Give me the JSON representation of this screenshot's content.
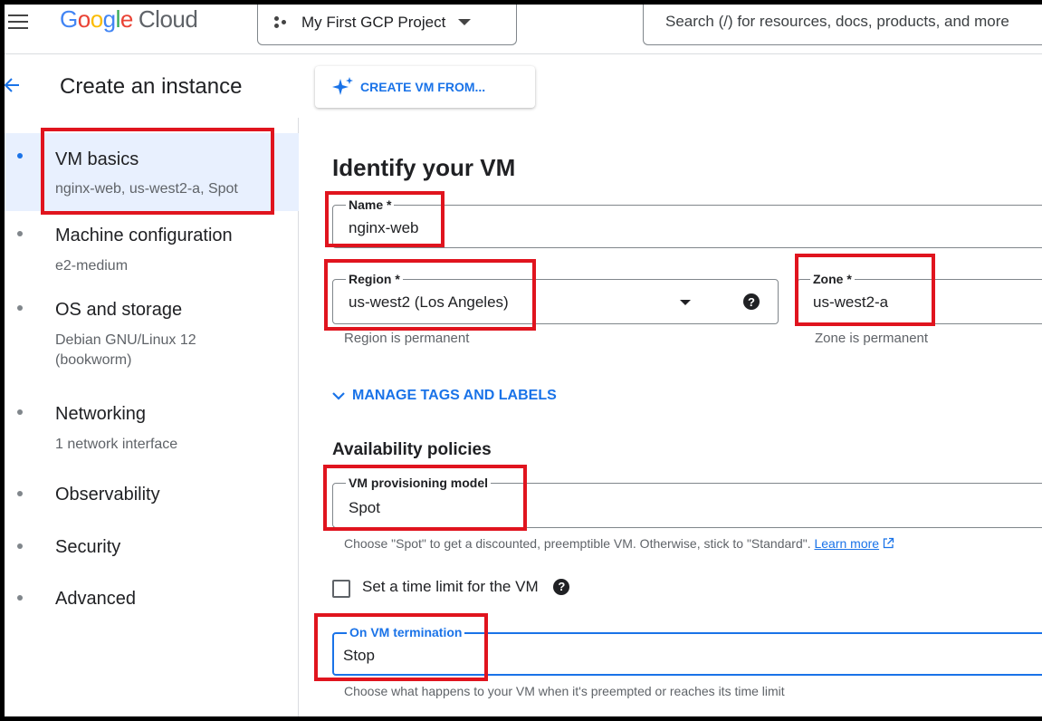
{
  "app": {
    "logo_text": "Google",
    "logo_suffix": "Cloud",
    "project_name": "My First GCP Project",
    "search_placeholder": "Search (/) for resources, docs, products, and more"
  },
  "header": {
    "title": "Create an instance",
    "create_vm_button": "CREATE VM FROM..."
  },
  "sidebar": {
    "items": [
      {
        "label": "VM basics",
        "sub": "nginx-web, us-west2-a, Spot"
      },
      {
        "label": "Machine configuration",
        "sub": "e2-medium"
      },
      {
        "label": "OS and storage",
        "sub": "Debian GNU/Linux 12 (bookworm)"
      },
      {
        "label": "Networking",
        "sub": "1 network interface"
      },
      {
        "label": "Observability",
        "sub": ""
      },
      {
        "label": "Security",
        "sub": ""
      },
      {
        "label": "Advanced",
        "sub": ""
      }
    ]
  },
  "main": {
    "section_title": "Identify your VM",
    "name_field": {
      "label": "Name *",
      "value": "nginx-web"
    },
    "region_field": {
      "label": "Region *",
      "value": "us-west2 (Los Angeles)",
      "hint": "Region is permanent"
    },
    "zone_field": {
      "label": "Zone *",
      "value": "us-west2-a",
      "hint": "Zone is permanent"
    },
    "manage_tags": "MANAGE TAGS AND LABELS",
    "availability_title": "Availability policies",
    "provisioning_field": {
      "label": "VM provisioning model",
      "value": "Spot",
      "hint": "Choose \"Spot\" to get a discounted, preemptible VM. Otherwise, stick to \"Standard\".",
      "learn_more": "Learn more"
    },
    "time_limit_label": "Set a time limit for the VM",
    "termination_field": {
      "label": "On VM termination",
      "value": "Stop",
      "hint": "Choose what happens to your VM when it's preempted or reaches its time limit"
    }
  },
  "colors": {
    "accent": "#1a73e8",
    "highlight": "#e0141e",
    "active_bg": "#e8f0fe"
  },
  "icons": [
    "menu-icon",
    "project-icon",
    "back-arrow-icon",
    "sparkle-icon",
    "chevron-down-icon",
    "help-icon",
    "external-link-icon"
  ]
}
